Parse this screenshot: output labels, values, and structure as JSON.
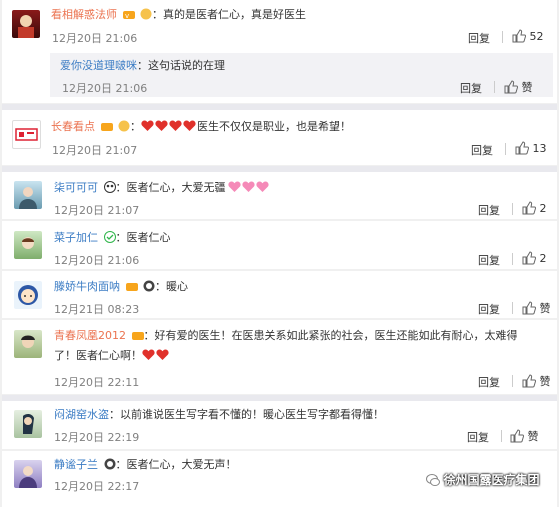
{
  "comments": [
    {
      "name": "看相解惑法师",
      "sep": "：",
      "text": "真的是医者仁心，真是好医生",
      "time": "12月20日 21:06",
      "reply": "回复",
      "likes": "52"
    },
    {
      "name": "爱你没道理啵咪",
      "sep": "：",
      "text": "这句话说的在理",
      "time": "12月20日 21:06",
      "reply": "回复",
      "likes": "赞"
    },
    {
      "name": "长春看点",
      "sep": "：",
      "text": "医生不仅仅是职业，也是希望！",
      "time": "12月20日 21:07",
      "reply": "回复",
      "likes": "13"
    },
    {
      "name": "柒可可可",
      "sep": "：",
      "text": "医者仁心，大爱无疆",
      "time": "12月20日 21:07",
      "reply": "回复",
      "likes": "2"
    },
    {
      "name": "菜子加仁",
      "sep": "：",
      "text": "医者仁心",
      "time": "12月20日 21:06",
      "reply": "回复",
      "likes": "2"
    },
    {
      "name": "滕娇牛肉面呐",
      "sep": "：",
      "text": "暖心",
      "time": "12月21日 08:23",
      "reply": "回复",
      "likes": "赞"
    },
    {
      "name": "青春凤凰2012",
      "sep": "：",
      "text": "好有爱的医生！在医患关系如此紧张的社会，医生还能如此有耐心，太难得",
      "text2": "了！医者仁心啊！",
      "time": "12月20日 22:11",
      "reply": "回复",
      "likes": "赞"
    },
    {
      "name": "闷湖窑水盗",
      "sep": "：",
      "text": "以前谁说医生写字看不懂的！暖心医生写字都看得懂！",
      "time": "12月20日 22:19",
      "reply": "回复",
      "likes": "赞"
    },
    {
      "name": "静谧子兰",
      "sep": "：",
      "text": "医者仁心，大爱无声！",
      "time": "12月20日 22:17",
      "reply": "回复",
      "likes": "赞"
    }
  ],
  "watermark": "徐州国露医疗集团",
  "colors": {
    "name": "#eb7350",
    "link": "#3b7cc4",
    "time": "#808080",
    "heart": "#e0312b"
  }
}
